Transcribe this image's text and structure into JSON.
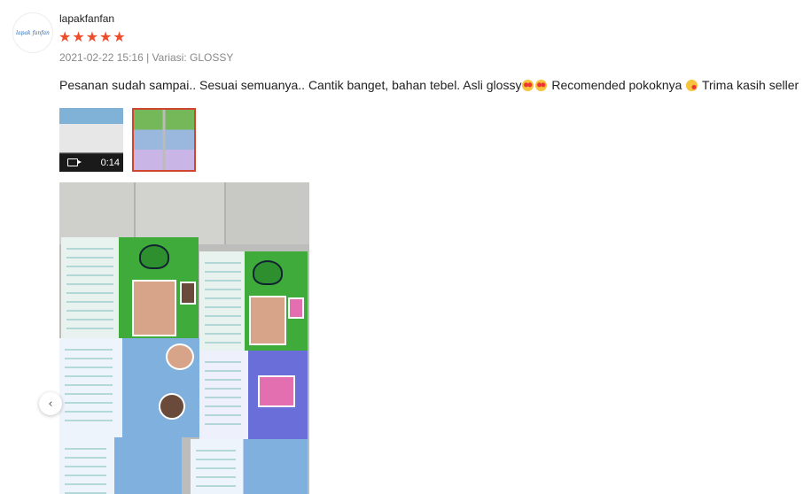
{
  "review": {
    "avatar_text": "lapak fanfan",
    "username": "lapakfanfan",
    "rating": 5,
    "stars": [
      "★",
      "★",
      "★",
      "★",
      "★"
    ],
    "meta": "2021-02-22 15:16 | Variasi: GLOSSY",
    "comment_part1": "Pesanan sudah sampai.. Sesuai semuanya.. Cantik banget, bahan tebel. Asli glossy",
    "comment_part2": " Recomended pokoknya",
    "comment_part3": " Trima kasih seller",
    "emoji_names": [
      "heart-eyes-emoji",
      "heart-eyes-emoji",
      "kissing-face-emoji"
    ]
  },
  "media": {
    "video_duration": "0:14",
    "selected_thumbnail": 2
  },
  "carousel": {
    "prev_icon": "‹"
  },
  "colors": {
    "star": "#ee4d2d",
    "selected_border": "#d0452d",
    "meta_text": "#888888"
  }
}
